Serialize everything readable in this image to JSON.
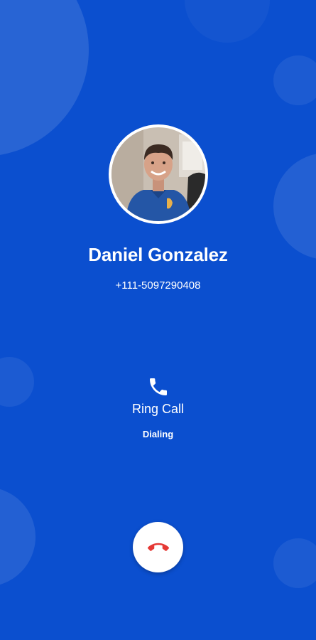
{
  "contact": {
    "name": "Daniel Gonzalez",
    "number": "+111-5097290408"
  },
  "call": {
    "type_label": "Ring Call",
    "status": "Dialing"
  },
  "icons": {
    "call": "phone-icon",
    "end_call": "end-call-icon"
  },
  "colors": {
    "background": "#0b4fcf",
    "end_call": "#e53935"
  }
}
